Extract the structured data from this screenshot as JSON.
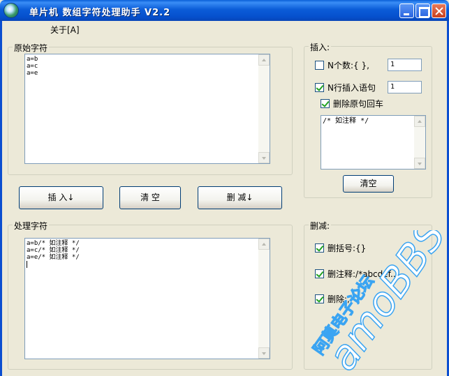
{
  "window": {
    "title": "单片机 数组字符处理助手 V2.2"
  },
  "menu": {
    "about": "关于[A]"
  },
  "original": {
    "label": "原始字符",
    "lines": [
      "a=b",
      "a=c",
      "a=e"
    ]
  },
  "buttons": {
    "insert": "插 入↓",
    "clear": "清 空",
    "delete": "删 减↓"
  },
  "processed": {
    "label": "处理字符",
    "lines": [
      "a=b/* 如注释 */",
      "a=c/* 如注释 */",
      "a=e/* 如注释 */"
    ]
  },
  "insert_panel": {
    "label": "插入:",
    "n_count": {
      "label": "N个数:{ },",
      "checked": false,
      "value": "1"
    },
    "n_row": {
      "label": "N行插入语句",
      "checked": true,
      "value": "1"
    },
    "delete_cr": {
      "label": "删除原句回车",
      "checked": true
    },
    "snippet_lines": [
      "/* 如注释 */"
    ],
    "clear_button": "清空"
  },
  "delete_panel": {
    "label": "删减:",
    "brackets": {
      "label": "删括号:{}",
      "checked": true
    },
    "comments": {
      "label": "删注释:/*abcdef...",
      "checked": true
    },
    "comma": {
      "label": "删除:,",
      "checked": true
    }
  },
  "watermark": {
    "line1": "阿莫电子论坛",
    "line2": "amoBBS"
  },
  "colors": {
    "titlebar": "#0b5cd8",
    "face": "#ece9d8",
    "watermark": "#3aa4f2"
  }
}
